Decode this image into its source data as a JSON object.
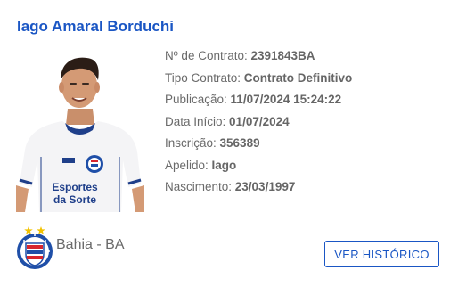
{
  "player": {
    "name": "Iago Amaral Borduchi",
    "jersey_sponsor_line1": "Esportes",
    "jersey_sponsor_line2": "da Sorte"
  },
  "details": [
    {
      "label": "Nº de Contrato: ",
      "value": "2391843BA"
    },
    {
      "label": "Tipo Contrato: ",
      "value": "Contrato Definitivo"
    },
    {
      "label": "Publicação: ",
      "value": "11/07/2024 15:24:22"
    },
    {
      "label": "Data Início: ",
      "value": "01/07/2024"
    },
    {
      "label": "Inscrição: ",
      "value": "356389"
    },
    {
      "label": "Apelido: ",
      "value": "Iago"
    },
    {
      "label": "Nascimento: ",
      "value": "23/03/1997"
    }
  ],
  "club": {
    "name": "Bahia - BA",
    "crest_icon": "bahia-crest-icon",
    "colors": {
      "blue": "#1f4fa8",
      "red": "#d7262e",
      "star": "#f2c200"
    }
  },
  "actions": {
    "history_label": "VER HISTÓRICO"
  },
  "theme": {
    "accent": "#1a56c4",
    "text": "#666666"
  }
}
